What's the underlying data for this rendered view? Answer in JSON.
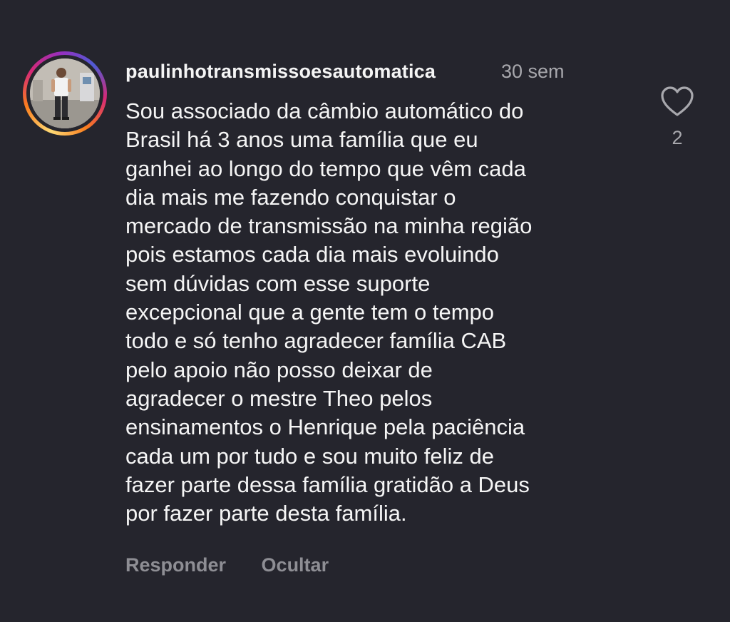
{
  "comment": {
    "username": "paulinhotransmissoesautomatica",
    "time_ago": "30 sem",
    "text_lines": [
      "Sou associado da câmbio automático do",
      "Brasil há 3 anos uma família que eu",
      "ganhei ao longo do tempo que vêm cada",
      "dia mais me fazendo conquistar o",
      "mercado de transmissão na minha região",
      "pois estamos cada dia mais evoluindo",
      "sem dúvidas com esse suporte",
      "excepcional que a gente tem o tempo",
      "todo e só tenho agradecer família CAB",
      "pelo apoio não posso deixar de",
      "agradecer o mestre Theo pelos",
      "ensinamentos o Henrique pela paciência",
      "cada um por tudo e sou muito feliz de",
      "fazer parte dessa família gratidão a Deus",
      "por fazer parte desta família."
    ],
    "like_count": "2",
    "actions": {
      "reply_label": "Responder",
      "hide_label": "Ocultar"
    }
  },
  "icons": {
    "like": "heart-outline-icon"
  },
  "colors": {
    "background": "#25252d",
    "text_primary": "#f5f5f5",
    "text_secondary": "#a8a8ad",
    "action_text": "#8e8e94"
  }
}
